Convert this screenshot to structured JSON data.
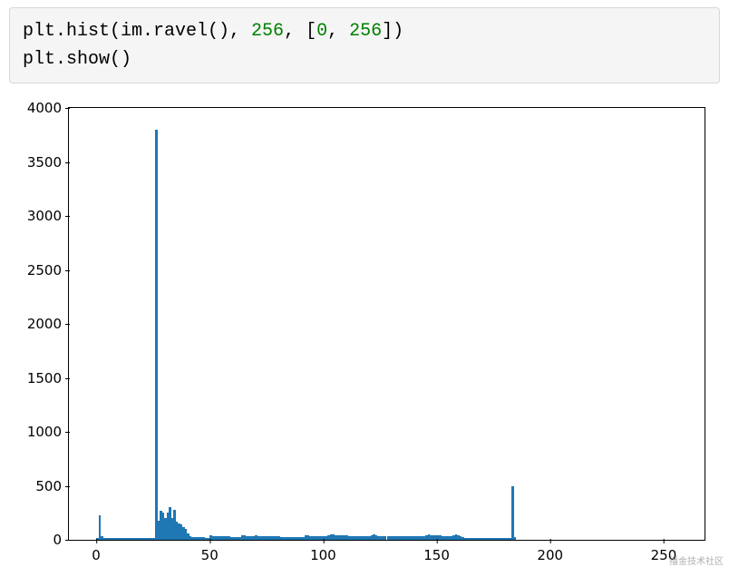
{
  "code": {
    "t1": "plt.hist(im.ravel(), ",
    "n1": "256",
    "t2": ", [",
    "n2": "0",
    "t3": ", ",
    "n3": "256",
    "t4": "])",
    "line2": "plt.show()"
  },
  "watermark": "播金技术社区",
  "chart_data": {
    "type": "bar",
    "title": "",
    "xlabel": "",
    "ylabel": "",
    "xlim": [
      -12,
      268
    ],
    "ylim": [
      0,
      4000
    ],
    "xticks": [
      0,
      50,
      100,
      150,
      200,
      250
    ],
    "yticks": [
      0,
      500,
      1000,
      1500,
      2000,
      2500,
      3000,
      3500,
      4000
    ],
    "categories_note": "x = pixel intensity bin (0-255)",
    "x": [
      0,
      1,
      2,
      3,
      4,
      5,
      6,
      7,
      8,
      9,
      10,
      11,
      12,
      13,
      14,
      15,
      16,
      17,
      18,
      19,
      20,
      21,
      22,
      23,
      24,
      25,
      26,
      27,
      28,
      29,
      30,
      31,
      32,
      33,
      34,
      35,
      36,
      37,
      38,
      39,
      40,
      41,
      42,
      43,
      44,
      45,
      46,
      47,
      48,
      49,
      50,
      51,
      52,
      53,
      54,
      55,
      56,
      57,
      58,
      59,
      60,
      61,
      62,
      63,
      64,
      65,
      66,
      67,
      68,
      69,
      70,
      71,
      72,
      73,
      74,
      75,
      76,
      77,
      78,
      79,
      80,
      81,
      82,
      83,
      84,
      85,
      86,
      87,
      88,
      89,
      90,
      91,
      92,
      93,
      94,
      95,
      96,
      97,
      98,
      99,
      100,
      101,
      102,
      103,
      104,
      105,
      106,
      107,
      108,
      109,
      110,
      111,
      112,
      113,
      114,
      115,
      116,
      117,
      118,
      119,
      120,
      121,
      122,
      123,
      124,
      125,
      126,
      127,
      128,
      129,
      130,
      131,
      132,
      133,
      134,
      135,
      136,
      137,
      138,
      139,
      140,
      141,
      142,
      143,
      144,
      145,
      146,
      147,
      148,
      149,
      150,
      151,
      152,
      153,
      154,
      155,
      156,
      157,
      158,
      159,
      160,
      161,
      162,
      163,
      164,
      165,
      166,
      167,
      168,
      169,
      170,
      171,
      172,
      173,
      174,
      175,
      176,
      177,
      178,
      179,
      180,
      181,
      182,
      183,
      184
    ],
    "values": [
      20,
      225,
      30,
      20,
      15,
      15,
      15,
      15,
      15,
      15,
      15,
      15,
      15,
      15,
      15,
      15,
      15,
      15,
      15,
      15,
      15,
      15,
      15,
      15,
      15,
      20,
      3800,
      180,
      270,
      250,
      200,
      250,
      300,
      200,
      280,
      170,
      150,
      140,
      120,
      100,
      60,
      30,
      25,
      25,
      25,
      25,
      25,
      25,
      20,
      20,
      40,
      35,
      30,
      30,
      30,
      30,
      30,
      30,
      30,
      25,
      25,
      25,
      25,
      25,
      40,
      45,
      30,
      30,
      30,
      35,
      40,
      35,
      30,
      30,
      30,
      30,
      30,
      30,
      30,
      30,
      30,
      25,
      25,
      25,
      25,
      25,
      25,
      25,
      25,
      25,
      25,
      25,
      40,
      40,
      35,
      30,
      30,
      30,
      30,
      30,
      30,
      35,
      40,
      50,
      50,
      45,
      40,
      40,
      40,
      40,
      40,
      35,
      30,
      30,
      30,
      30,
      30,
      30,
      30,
      30,
      30,
      45,
      50,
      45,
      35,
      30,
      30,
      30,
      30,
      30,
      30,
      30,
      30,
      30,
      30,
      30,
      30,
      30,
      30,
      30,
      30,
      30,
      30,
      30,
      30,
      40,
      50,
      45,
      40,
      40,
      40,
      40,
      35,
      30,
      30,
      30,
      30,
      45,
      50,
      45,
      30,
      25,
      20,
      20,
      20,
      20,
      20,
      20,
      20,
      20,
      20,
      20,
      20,
      20,
      20,
      20,
      20,
      20,
      20,
      20,
      20,
      20,
      20,
      500,
      22
    ],
    "bar_color": "#1f77b4"
  }
}
